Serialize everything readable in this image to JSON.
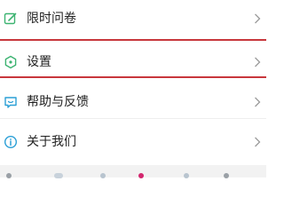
{
  "accent_color": "#c8373c",
  "menu": {
    "items": [
      {
        "label": "限时问卷",
        "icon": "edit-icon"
      },
      {
        "label": "设置",
        "icon": "hexagon-settings-icon"
      },
      {
        "label": "帮助与反馈",
        "icon": "feedback-icon"
      },
      {
        "label": "关于我们",
        "icon": "info-icon"
      }
    ]
  }
}
